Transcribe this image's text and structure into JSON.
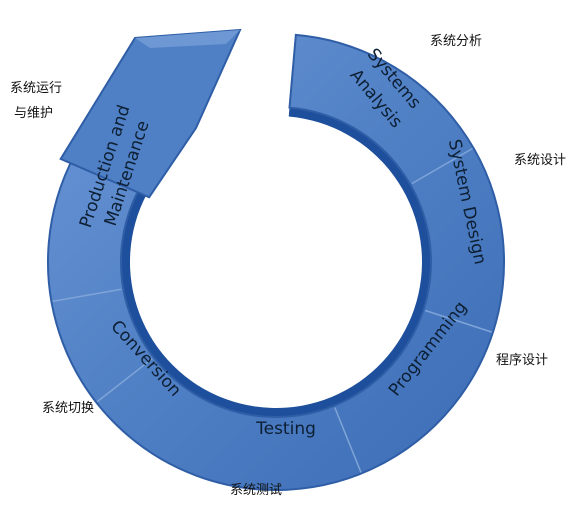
{
  "stages": [
    {
      "id": "analysis",
      "en": [
        "Systems",
        "Analysis"
      ],
      "zh": [
        "系统分析"
      ]
    },
    {
      "id": "design",
      "en": [
        "System Design"
      ],
      "zh": [
        "系统设计"
      ]
    },
    {
      "id": "programming",
      "en": [
        "Programming"
      ],
      "zh": [
        "程序设计"
      ]
    },
    {
      "id": "testing",
      "en": [
        "Testing"
      ],
      "zh": [
        "系统测试"
      ]
    },
    {
      "id": "conversion",
      "en": [
        "Conversion"
      ],
      "zh": [
        "系统切换"
      ]
    },
    {
      "id": "maintenance",
      "en": [
        "Production and",
        "Maintenance"
      ],
      "zh": [
        "系统运行",
        "与维护"
      ]
    }
  ],
  "colors": {
    "ring_fill": "#4f7fc4",
    "ring_edge": "#2f5ea6",
    "inner_band": "#1e4f9c",
    "divider": "#7ea4d8",
    "arrow_tip": "#6e98d4"
  }
}
